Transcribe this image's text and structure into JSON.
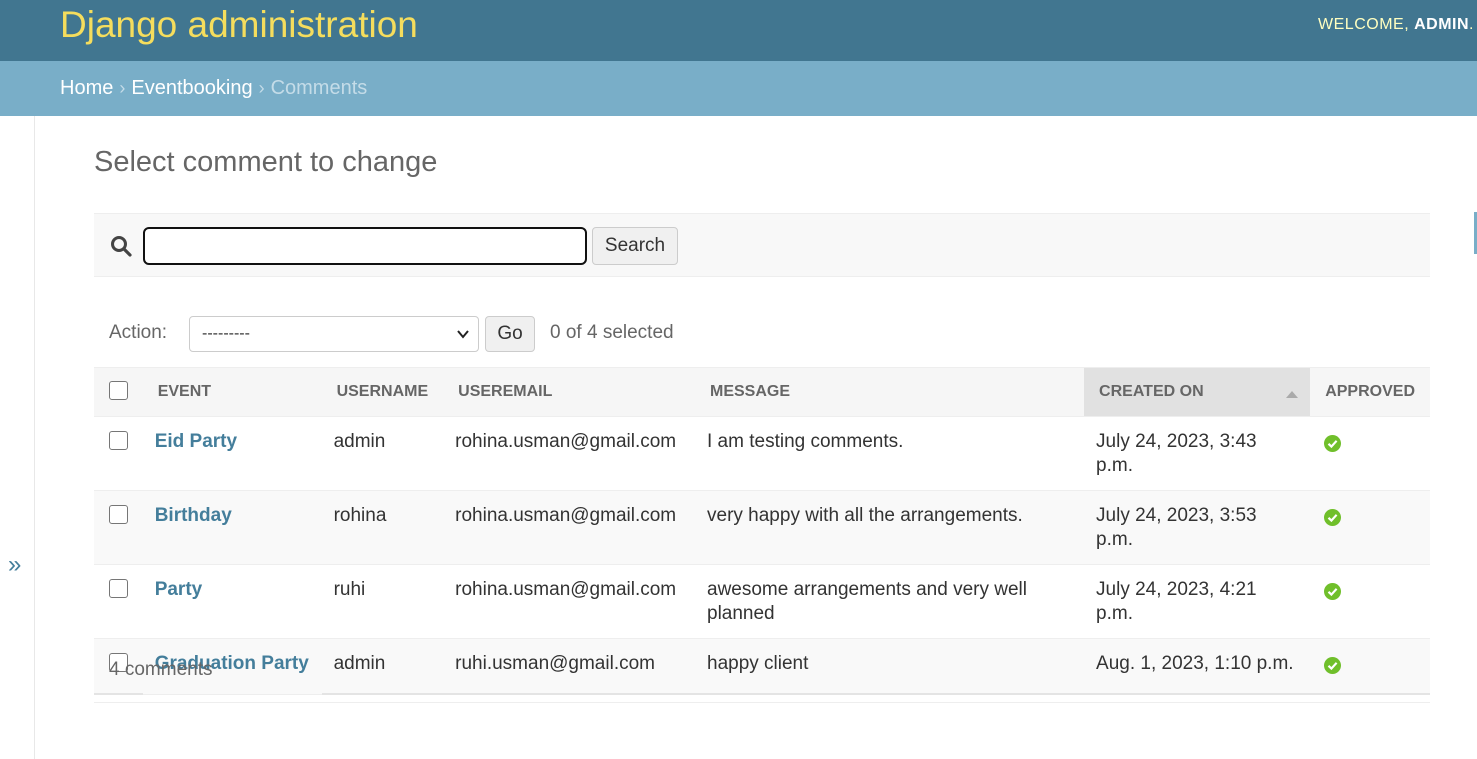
{
  "header": {
    "brand": "Django administration",
    "welcome": "WELCOME,",
    "username": "ADMIN",
    "trailing": ".",
    "brand_color": "#f5dd5d",
    "bar_color": "#417690"
  },
  "breadcrumbs": {
    "home": "Home",
    "app": "Eventbooking",
    "current": "Comments",
    "separator": "›"
  },
  "nav_toggle": "»",
  "page_title": "Select comment to change",
  "search": {
    "value": "",
    "button": "Search"
  },
  "actions": {
    "label": "Action:",
    "selected_value": "---------",
    "go": "Go",
    "selected_count": "0 of 4 selected"
  },
  "table": {
    "columns": [
      "Event",
      "Username",
      "Useremail",
      "Message",
      "Created on",
      "Approved"
    ],
    "sorted_column": "Created on",
    "sort_direction": "ascending",
    "rows": [
      {
        "event": "Eid Party",
        "username": "admin",
        "useremail": "rohina.usman@gmail.com",
        "message": "I am testing comments.",
        "created_on": "July 24, 2023, 3:43 p.m.",
        "approved": true
      },
      {
        "event": "Birthday",
        "username": "rohina",
        "useremail": "rohina.usman@gmail.com",
        "message": "very happy with all the arrangements.",
        "created_on": "July 24, 2023, 3:53 p.m.",
        "approved": true
      },
      {
        "event": "Party",
        "username": "ruhi",
        "useremail": "rohina.usman@gmail.com",
        "message": "awesome arrangements and very well planned",
        "created_on": "July 24, 2023, 4:21 p.m.",
        "approved": true
      },
      {
        "event": "Graduation Party",
        "username": "admin",
        "useremail": "ruhi.usman@gmail.com",
        "message": "happy client",
        "created_on": "Aug. 1, 2023, 1:10 p.m.",
        "approved": true
      }
    ]
  },
  "paginator": "4 comments",
  "icons": {
    "search": "search-icon",
    "approved": "check-circle-icon",
    "sort": "sort-ascending-icon",
    "select_chevron": "chevron-down-icon"
  },
  "colors": {
    "link": "#447e9b",
    "approved": "#70bf2b",
    "breadcrumb_bar": "#79aec8"
  }
}
